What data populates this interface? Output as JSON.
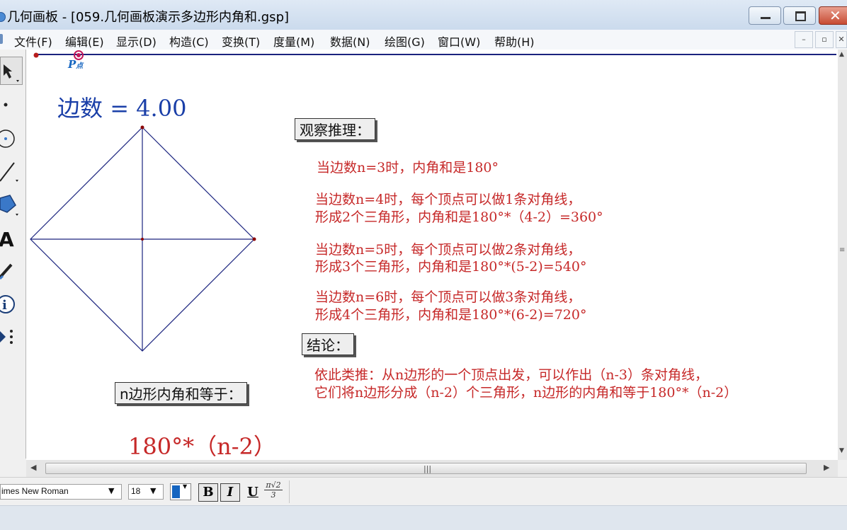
{
  "window": {
    "title": "几何画板 - [059.几何画板演示多边形内角和.gsp]"
  },
  "menu": [
    "文件(F)",
    "编辑(E)",
    "显示(D)",
    "构造(C)",
    "变换(T)",
    "度量(M)",
    "数据(N)",
    "绘图(G)",
    "窗口(W)",
    "帮助(H)"
  ],
  "canvas": {
    "point_label": "P",
    "point_subscript": "点",
    "sides_label": "边数",
    "sides_eq": "=",
    "sides_value": "4.00",
    "observe_title": "观察推理：",
    "obs_n3": "当边数n=3时，内角和是180°",
    "obs_n4_1": "当边数n=4时，每个顶点可以做1条对角线，",
    "obs_n4_2": "形成2个三角形，内角和是180°*（4-2）=360°",
    "obs_n5_1": "当边数n=5时，每个顶点可以做2条对角线，",
    "obs_n5_2": "形成3个三角形，内角和是180°*(5-2)=540°",
    "obs_n6_1": "当边数n=6时，每个顶点可以做3条对角线，",
    "obs_n6_2": "形成4个三角形，内角和是180°*(6-2)=720°",
    "conclusion_title": "结论：",
    "conclusion_1": "依此类推：从n边形的一个顶点出发，可以作出（n-3）条对角线，",
    "conclusion_2": "它们将n边形分成（n-2）个三角形，n边形的内角和等于180°*（n-2）",
    "formula_title": "n边形内角和等于：",
    "formula": "180°*（n-2）"
  },
  "textbar": {
    "font_name": "imes New Roman",
    "font_size": "18",
    "bold": "B",
    "italic": "I",
    "underline": "U",
    "math_top": "π√2",
    "math_bottom": "3"
  },
  "colors": {
    "dark_blue": "#1a237e",
    "red_text": "#c62828",
    "magenta_point": "#c2185b"
  },
  "icons": [
    "arrow-select-icon",
    "point-tool-icon",
    "compass-tool-icon",
    "straightedge-tool-icon",
    "polygon-tool-icon",
    "text-tool-icon",
    "marker-tool-icon",
    "information-tool-icon",
    "custom-tool-icon"
  ]
}
